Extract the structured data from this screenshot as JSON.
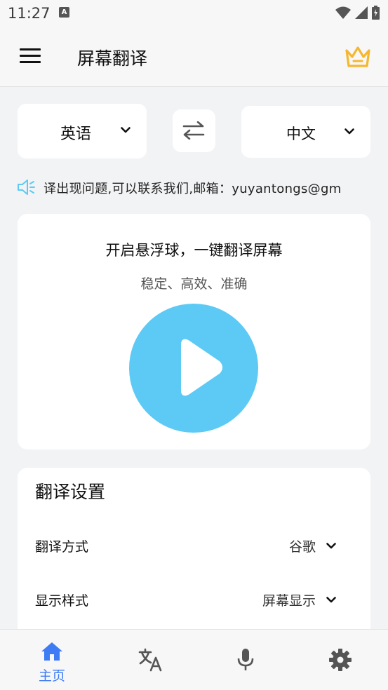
{
  "status_bar": {
    "time": "11:27",
    "notification_icon": "a-icon"
  },
  "header": {
    "title": "屏幕翻译",
    "menu_icon": "hamburger-menu-icon",
    "premium_icon": "crown-icon",
    "premium_color": "#f5b731"
  },
  "languages": {
    "source": "英语",
    "target": "中文",
    "swap_icon": "swap-arrows-icon"
  },
  "notice": {
    "text": "译出现问题,可以联系我们,邮箱：yuyantongs@gm"
  },
  "float_ball": {
    "title": "开启悬浮球，一键翻译屏幕",
    "subtitle": "稳定、高效、准确",
    "button_color": "#5ccaf5"
  },
  "settings": {
    "title": "翻译设置",
    "rows": [
      {
        "label": "翻译方式",
        "value": "谷歌"
      },
      {
        "label": "显示样式",
        "value": "屏幕显示"
      }
    ]
  },
  "bottom_nav": {
    "active_color": "#3d7cf5",
    "items": [
      {
        "label": "主页",
        "icon": "home-icon",
        "active": true
      },
      {
        "icon": "translate-icon"
      },
      {
        "icon": "microphone-icon"
      },
      {
        "icon": "settings-gear-icon"
      }
    ]
  }
}
